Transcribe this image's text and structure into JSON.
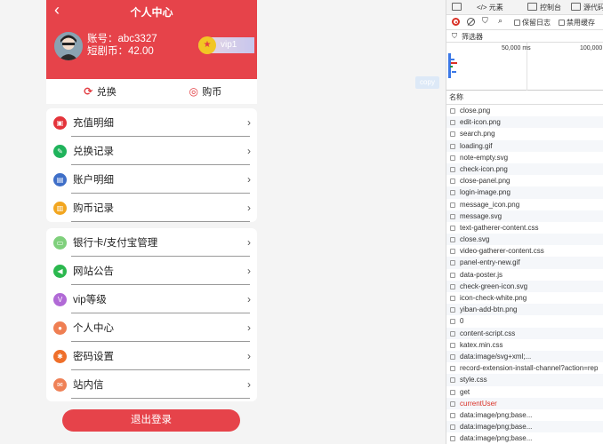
{
  "app": {
    "header": {
      "title": "个人中心",
      "back": "‹"
    },
    "account": {
      "username": "账号：abc3327",
      "balance": "短剧币：42.00"
    },
    "vip_badge": {
      "label": "vip1"
    },
    "actions": [
      {
        "label": "兑换",
        "icon": "exchange-icon"
      },
      {
        "label": "购币",
        "icon": "coins-icon"
      }
    ],
    "menu_group_1": [
      {
        "label": "充值明细",
        "icon": "recharge-icon",
        "color": "#e4343b"
      },
      {
        "label": "兑换记录",
        "icon": "exchange-record-icon",
        "color": "#1fb35b"
      },
      {
        "label": "账户明细",
        "icon": "account-icon",
        "color": "#3f6fc8"
      },
      {
        "label": "购币记录",
        "icon": "purchase-icon",
        "color": "#f2a620"
      }
    ],
    "menu_group_2": [
      {
        "label": "银行卡/支付宝管理",
        "icon": "bank-card-icon",
        "color": "#7fd07c"
      },
      {
        "label": "网站公告",
        "icon": "announcement-icon",
        "color": "#2bb84e"
      },
      {
        "label": "vip等级",
        "icon": "vip-icon",
        "color": "#b16ad6"
      },
      {
        "label": "个人中心",
        "icon": "user-icon",
        "color": "#ef7f53"
      },
      {
        "label": "密码设置",
        "icon": "lock-icon",
        "color": "#ef6f2a"
      },
      {
        "label": "站内信",
        "icon": "mail-icon",
        "color": "#ef8157"
      }
    ],
    "logout_label": "退出登录",
    "accent_color": "#e6434a"
  },
  "copy_chip": "copy",
  "devtools": {
    "tabs": [
      "元素",
      "控制台",
      "源代码"
    ],
    "toolbar": {
      "preserve_log": "保留日志",
      "disable_cache": "禁用缓存"
    },
    "filter_label": "筛选器",
    "timeline": {
      "ticks": [
        "50,000 ms",
        "100,000"
      ]
    },
    "column_header": "名称",
    "requests": [
      {
        "name": "close.png",
        "status": "ok"
      },
      {
        "name": "edit-icon.png",
        "status": "ok"
      },
      {
        "name": "search.png",
        "status": "ok"
      },
      {
        "name": "loading.gif",
        "status": "ok"
      },
      {
        "name": "note-empty.svg",
        "status": "ok"
      },
      {
        "name": "check-icon.png",
        "status": "ok"
      },
      {
        "name": "close-panel.png",
        "status": "ok"
      },
      {
        "name": "login-image.png",
        "status": "ok"
      },
      {
        "name": "message_icon.png",
        "status": "ok"
      },
      {
        "name": "message.svg",
        "status": "ok"
      },
      {
        "name": "text-gatherer-content.css",
        "status": "ok"
      },
      {
        "name": "close.svg",
        "status": "ok"
      },
      {
        "name": "video-gatherer-content.css",
        "status": "ok"
      },
      {
        "name": "panel-entry-new.gif",
        "status": "ok"
      },
      {
        "name": "data-poster.js",
        "status": "ok"
      },
      {
        "name": "check-green-icon.svg",
        "status": "ok"
      },
      {
        "name": "icon-check-white.png",
        "status": "ok"
      },
      {
        "name": "yiban-add-btn.png",
        "status": "ok"
      },
      {
        "name": "0",
        "status": "ok"
      },
      {
        "name": "content-script.css",
        "status": "ok"
      },
      {
        "name": "katex.min.css",
        "status": "ok"
      },
      {
        "name": "data:image/svg+xml;...",
        "status": "ok"
      },
      {
        "name": "record-extension-install-channel?action=rep",
        "status": "ok"
      },
      {
        "name": "style.css",
        "status": "ok"
      },
      {
        "name": "get",
        "status": "ok"
      },
      {
        "name": "currentUser",
        "status": "error"
      },
      {
        "name": "data:image/png;base...",
        "status": "ok"
      },
      {
        "name": "data:image/png;base...",
        "status": "ok"
      },
      {
        "name": "data:image/png;base...",
        "status": "ok"
      }
    ]
  }
}
